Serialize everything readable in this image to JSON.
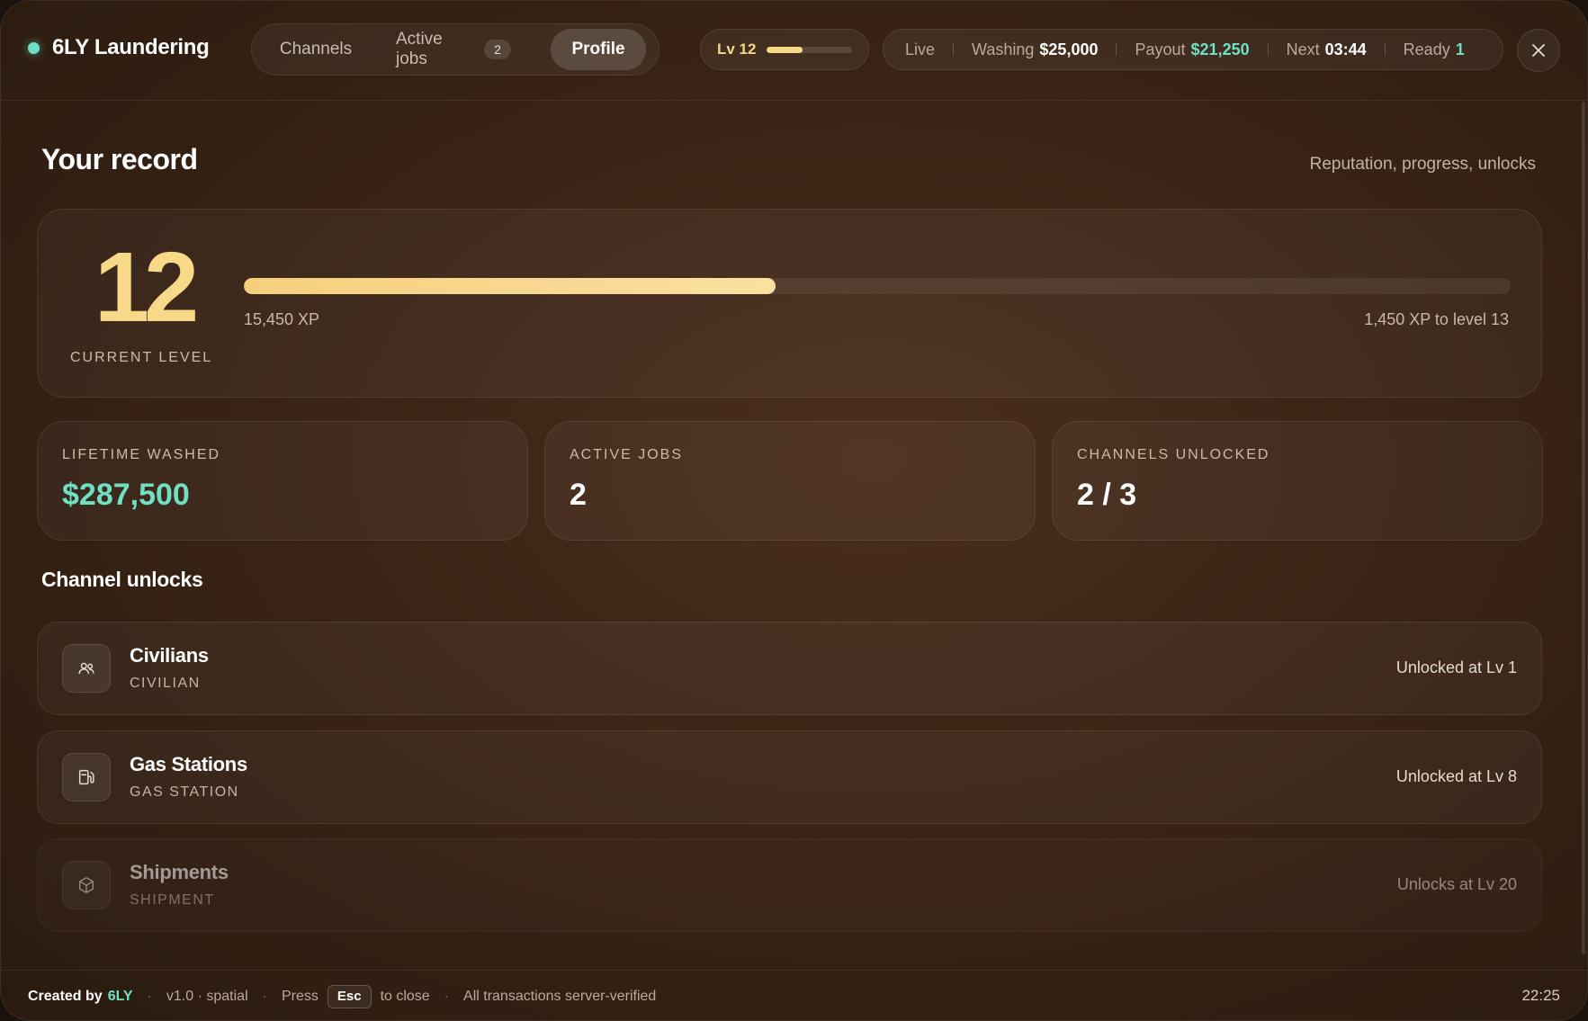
{
  "brand": {
    "name": "6LY Laundering"
  },
  "nav": {
    "tabs": [
      {
        "label": "Channels"
      },
      {
        "label": "Active jobs",
        "badge": "2"
      },
      {
        "label": "Profile",
        "active": true
      }
    ]
  },
  "level_pill": {
    "label": "Lv 12",
    "progress": 0.42
  },
  "status": {
    "live": "Live",
    "washing_label": "Washing",
    "washing_value": "$25,000",
    "payout_label": "Payout",
    "payout_value": "$21,250",
    "next_label": "Next",
    "next_value": "03:44",
    "ready_label": "Ready",
    "ready_value": "1"
  },
  "page": {
    "title": "Your record",
    "subtitle": "Reputation, progress, unlocks"
  },
  "level_card": {
    "level": "12",
    "label": "CURRENT LEVEL",
    "xp": "15,450 XP",
    "xp_to_next": "1,450 XP to level 13",
    "progress": 0.42
  },
  "stats": [
    {
      "label": "LIFETIME WASHED",
      "value": "$287,500"
    },
    {
      "label": "ACTIVE JOBS",
      "value": "2"
    },
    {
      "label": "CHANNELS UNLOCKED",
      "value": "2 / 3"
    }
  ],
  "unlocks": {
    "title": "Channel unlocks",
    "items": [
      {
        "name": "Civilians",
        "code": "CIVILIAN",
        "status": "Unlocked at Lv 1",
        "icon": "users-icon",
        "locked": false
      },
      {
        "name": "Gas Stations",
        "code": "GAS STATION",
        "status": "Unlocked at Lv 8",
        "icon": "fuel-pump-icon",
        "locked": false
      },
      {
        "name": "Shipments",
        "code": "SHIPMENT",
        "status": "Unlocks at Lv 20",
        "icon": "package-icon",
        "locked": true
      }
    ]
  },
  "footer": {
    "created_by": "Created by",
    "author": "6LY",
    "version": "v1.0 · spatial",
    "press": "Press",
    "key": "Esc",
    "to_close": "to close",
    "verified": "All transactions server-verified",
    "time": "22:25"
  },
  "colors": {
    "accent_green": "#6fe0c4",
    "accent_gold": "#f8d98a",
    "background": "#3a2415"
  }
}
